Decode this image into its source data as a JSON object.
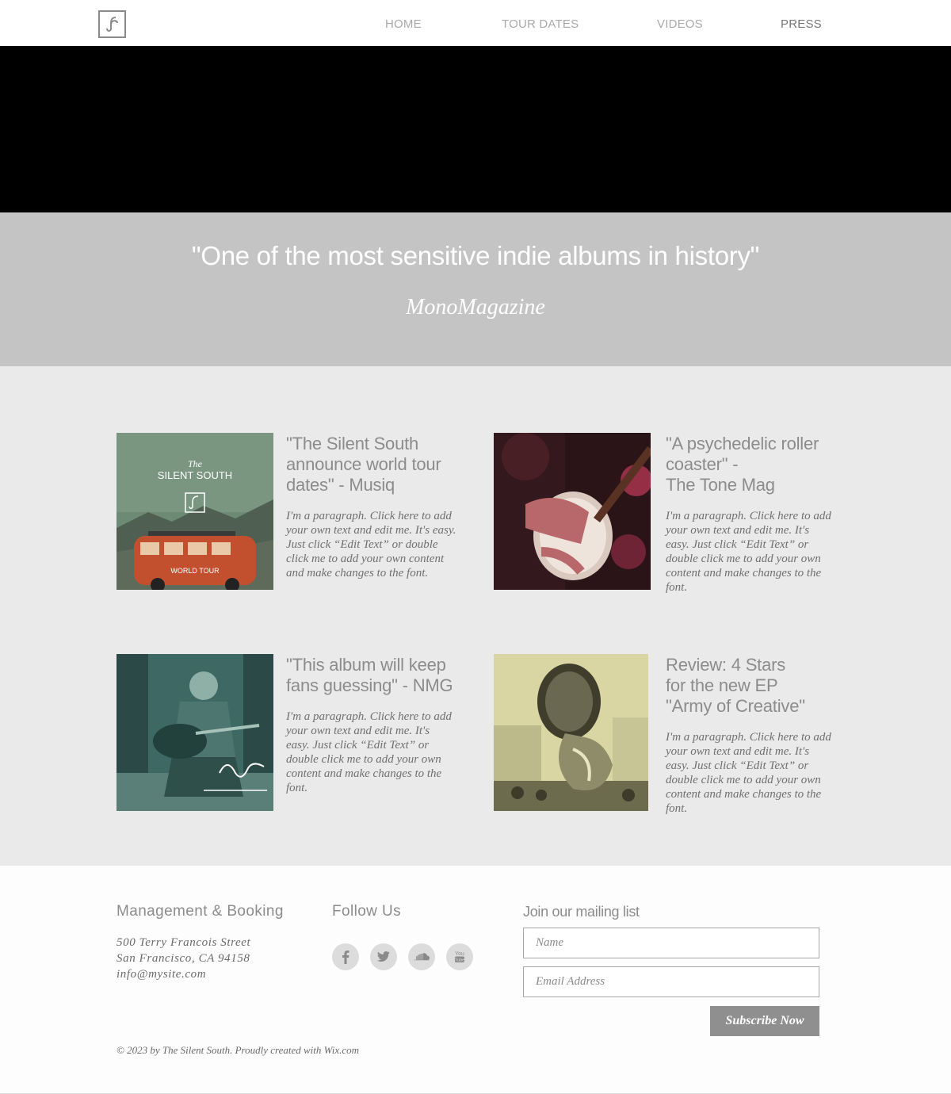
{
  "nav": {
    "items": [
      {
        "label": "HOME"
      },
      {
        "label": "TOUR DATES"
      },
      {
        "label": "VIDEOS"
      },
      {
        "label": "PRESS"
      }
    ],
    "active": "PRESS"
  },
  "quote": {
    "text": "\"One of the most sensitive indie albums in history\"",
    "source": "MonoMagazine"
  },
  "cards": [
    {
      "title_lines": [
        "\"The Silent South",
        "announce world tour",
        "dates\" - Musiq"
      ],
      "body_lines": [
        "I'm a paragraph. Click here to add",
        "your own text and edit me. It's easy.",
        "Just click “Edit Text” or double",
        "click me to add your own content",
        "and make changes to the font."
      ],
      "image": {
        "top_text": "The",
        "title": "SILENT SOUTH",
        "bottom_text": "WORLD TOUR"
      }
    },
    {
      "title_lines": [
        "\"A psychedelic roller",
        "coaster\" -",
        "The Tone Mag"
      ],
      "body_lines": [
        "I'm a paragraph. Click here to add",
        "your own text and edit me. It's",
        "easy. Just click “Edit Text” or",
        "double click me to add your own",
        "content and make changes to the",
        "font."
      ]
    },
    {
      "title_lines": [
        "\"This album will keep",
        "fans guessing\" - NMG"
      ],
      "body_lines": [
        "I'm a paragraph. Click here to add",
        "your own text and edit me. It's",
        "easy. Just click “Edit Text” or",
        "double click me to add your own",
        "content and make changes to the",
        "font."
      ]
    },
    {
      "title_lines": [
        "Review: 4 Stars",
        "for the new EP",
        "\"Army of Creative\""
      ],
      "body_lines": [
        "I'm a paragraph. Click here to add",
        "your own text and edit me. It's",
        "easy. Just click “Edit Text” or",
        "double click me to add your own",
        "content and make changes to the",
        "font."
      ]
    }
  ],
  "footer": {
    "management_heading": "Management & Booking",
    "address_lines": [
      "500 Terry Francois Street",
      "San Francisco, CA 94158",
      "info@mysite.com"
    ],
    "follow_heading": "Follow Us",
    "social_icons": [
      "facebook-icon",
      "twitter-icon",
      "soundcloud-icon",
      "youtube-icon"
    ],
    "mailing_heading": "Join our mailing list",
    "name_placeholder": "Name",
    "email_placeholder": "Email Address",
    "subscribe_label": "Subscribe Now",
    "copyright": "© 2023 by The Silent South. Proudly created with Wix.com"
  },
  "colors": {
    "hero": "#000000",
    "quote_band": "#c4c4c4",
    "press_bg": "#eaeaea",
    "button": "#8f8f8f"
  }
}
